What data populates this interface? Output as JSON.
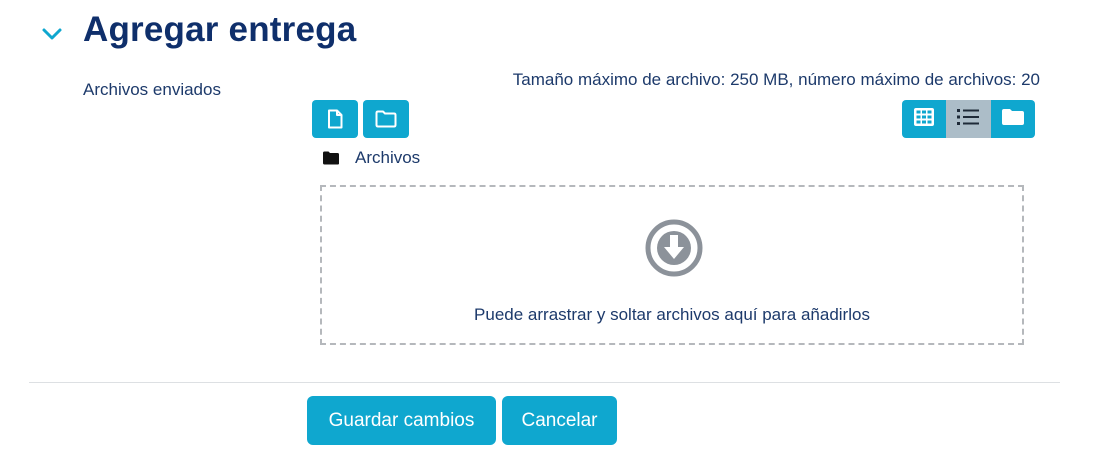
{
  "section": {
    "title": "Agregar entrega",
    "toggle_icon": "chevron-down-icon"
  },
  "field": {
    "label": "Archivos enviados"
  },
  "filepicker": {
    "limits": "Tamaño máximo de archivo: 250 MB, número máximo de archivos: 20",
    "toolbar": {
      "add_file_icon": "file-icon",
      "add_folder_icon": "folder-open-icon",
      "view_icons": [
        "grid-icon",
        "list-icon",
        "folder-icon"
      ],
      "active_view": "list-icon"
    },
    "path": {
      "folder_icon": "folder-icon",
      "label": "Archivos"
    },
    "dropzone": {
      "icon": "download-circle-icon",
      "text": "Puede arrastrar y soltar archivos aquí para añadirlos"
    }
  },
  "actions": {
    "save_label": "Guardar cambios",
    "cancel_label": "Cancelar"
  },
  "colors": {
    "primary": "#0fa7cf",
    "active_view": "#acbdc8",
    "title": "#0f2f6b",
    "text": "#1d3a6b",
    "dropzone_border": "#b5b8bc",
    "dropzone_icon": "#8c929a"
  }
}
